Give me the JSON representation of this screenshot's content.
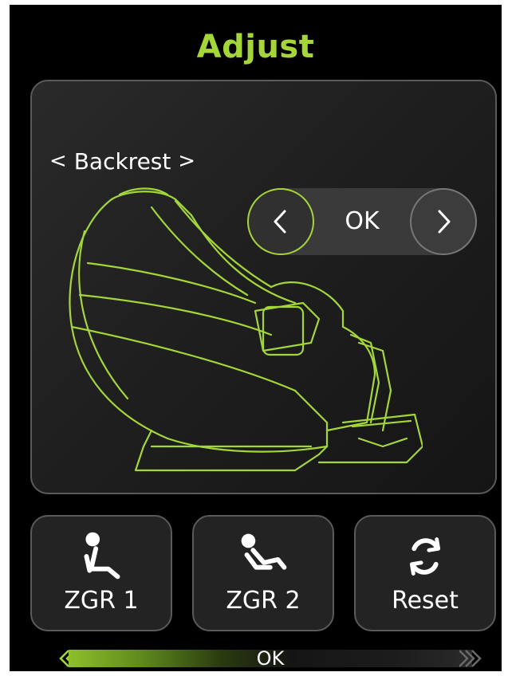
{
  "header": {
    "title": "Adjust"
  },
  "adjust_panel": {
    "part_label": "Backrest",
    "prev_part_glyph": "<",
    "next_part_glyph": ">",
    "confirm_label": "OK"
  },
  "mode_buttons": [
    {
      "label": "ZGR 1",
      "icon": "zero-gravity-1-icon"
    },
    {
      "label": "ZGR 2",
      "icon": "zero-gravity-2-icon"
    },
    {
      "label": "Reset",
      "icon": "refresh-icon"
    }
  ],
  "status": {
    "label": "OK"
  },
  "colors": {
    "accent": "#a4d63a",
    "background": "#000000",
    "panel": "#222222"
  }
}
